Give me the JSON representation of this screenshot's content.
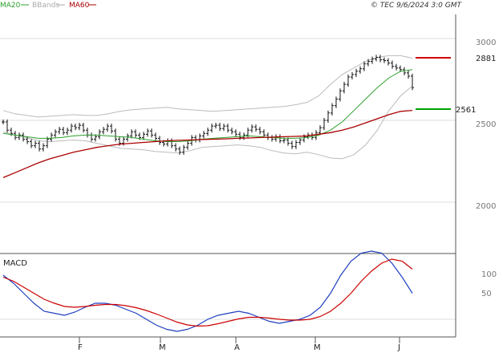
{
  "chart_data": [
    {
      "type": "line",
      "panel": "price",
      "header_right": "© TEC 9/6/2024 3:0 GMT",
      "legend": [
        {
          "label": "MA20",
          "color": "#2ca02c"
        },
        {
          "label": "BBands",
          "color": "#aaaaaa"
        },
        {
          "label": "MA60",
          "color": "#aa0000"
        }
      ],
      "y_ticks": [
        "3000",
        "2500",
        "2000"
      ],
      "ylim": [
        1720,
        3070
      ],
      "x_ticks": [
        "F",
        "M",
        "A",
        "M",
        "J"
      ],
      "resistance": {
        "label": "2881",
        "value": 2881,
        "color": "#cc0000"
      },
      "support": {
        "label": "2561",
        "value": 2561,
        "color": "#00a000"
      },
      "ohlc_daily_closes": [
        2490,
        2440,
        2420,
        2395,
        2410,
        2385,
        2370,
        2345,
        2360,
        2325,
        2345,
        2385,
        2410,
        2430,
        2445,
        2425,
        2440,
        2465,
        2455,
        2470,
        2440,
        2410,
        2385,
        2400,
        2430,
        2445,
        2465,
        2435,
        2385,
        2360,
        2385,
        2405,
        2430,
        2410,
        2395,
        2415,
        2435,
        2410,
        2390,
        2365,
        2355,
        2375,
        2345,
        2325,
        2305,
        2335,
        2360,
        2395,
        2380,
        2405,
        2420,
        2440,
        2465,
        2470,
        2450,
        2465,
        2440,
        2430,
        2415,
        2395,
        2410,
        2440,
        2460,
        2445,
        2430,
        2410,
        2395,
        2385,
        2400,
        2375,
        2380,
        2360,
        2340,
        2365,
        2380,
        2400,
        2410,
        2395,
        2425,
        2455,
        2500,
        2545,
        2590,
        2630,
        2680,
        2720,
        2765,
        2780,
        2800,
        2815,
        2845,
        2860,
        2875,
        2885,
        2870,
        2865,
        2850,
        2830,
        2820,
        2810,
        2790,
        2770,
        2700
      ],
      "bbands_upper": [
        2560,
        2540,
        2530,
        2520,
        2525,
        2530,
        2535,
        2530,
        2530,
        2540,
        2555,
        2565,
        2570,
        2575,
        2580,
        2570,
        2565,
        2560,
        2555,
        2560,
        2565,
        2570,
        2575,
        2580,
        2585,
        2595,
        2610,
        2650,
        2720,
        2780,
        2820,
        2860,
        2885,
        2895,
        2895,
        2880
      ],
      "bbands_lower": [
        2430,
        2410,
        2395,
        2375,
        2370,
        2375,
        2380,
        2375,
        2360,
        2345,
        2330,
        2325,
        2320,
        2310,
        2305,
        2300,
        2315,
        2335,
        2340,
        2345,
        2350,
        2345,
        2335,
        2315,
        2300,
        2295,
        2305,
        2290,
        2270,
        2265,
        2290,
        2350,
        2440,
        2560,
        2650,
        2710
      ],
      "ma20": [
        2420,
        2410,
        2400,
        2390,
        2390,
        2395,
        2405,
        2410,
        2410,
        2405,
        2400,
        2395,
        2385,
        2375,
        2370,
        2370,
        2375,
        2385,
        2390,
        2395,
        2400,
        2405,
        2400,
        2395,
        2390,
        2390,
        2395,
        2410,
        2440,
        2490,
        2560,
        2630,
        2700,
        2760,
        2800,
        2810
      ],
      "ma60": [
        2150,
        2180,
        2210,
        2240,
        2265,
        2285,
        2305,
        2320,
        2335,
        2345,
        2355,
        2360,
        2365,
        2370,
        2375,
        2378,
        2380,
        2383,
        2385,
        2387,
        2390,
        2392,
        2395,
        2397,
        2400,
        2402,
        2405,
        2415,
        2425,
        2440,
        2460,
        2485,
        2510,
        2535,
        2555,
        2561
      ]
    },
    {
      "type": "line",
      "panel": "macd",
      "title": "MACD",
      "y_ticks": [
        "100",
        "50"
      ],
      "ylim": [
        -110,
        165
      ],
      "macd": [
        100,
        80,
        55,
        30,
        10,
        5,
        0,
        8,
        20,
        30,
        30,
        25,
        15,
        5,
        -10,
        -25,
        -35,
        -40,
        -35,
        -25,
        -10,
        0,
        5,
        10,
        5,
        -5,
        -15,
        -20,
        -15,
        -10,
        0,
        20,
        55,
        100,
        135,
        155,
        160,
        155,
        130,
        95,
        55
      ],
      "signal": [
        95,
        85,
        70,
        55,
        40,
        30,
        22,
        20,
        22,
        25,
        27,
        27,
        24,
        19,
        12,
        3,
        -7,
        -17,
        -24,
        -27,
        -26,
        -21,
        -15,
        -9,
        -5,
        -5,
        -7,
        -10,
        -12,
        -12,
        -10,
        -3,
        10,
        30,
        55,
        85,
        110,
        130,
        140,
        135,
        115
      ]
    }
  ]
}
